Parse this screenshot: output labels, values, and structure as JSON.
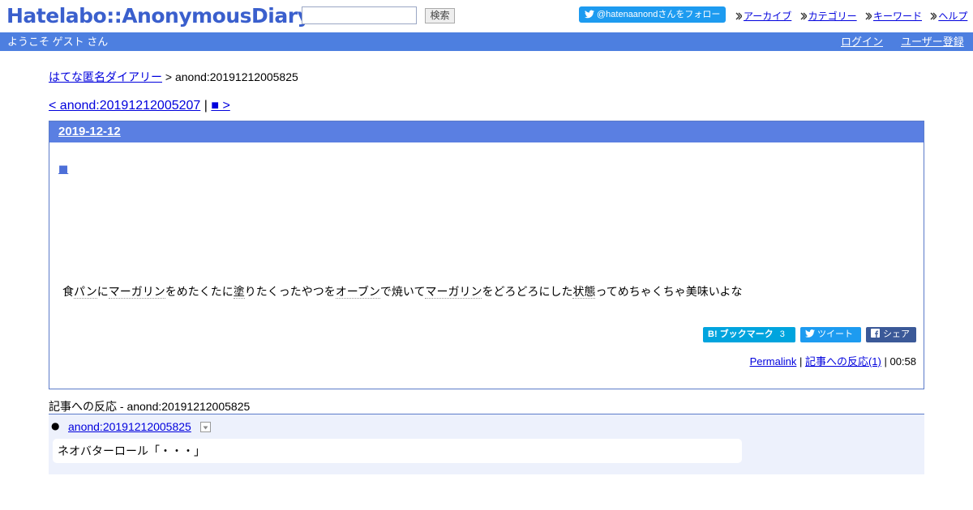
{
  "header": {
    "logo": "Hatelabo::AnonymousDiary",
    "search": {
      "value": "",
      "button": "検索"
    },
    "follow": "@hatenaanondさんをフォロー",
    "links": [
      "アーカイブ",
      "カテゴリー",
      "キーワード",
      "ヘルプ"
    ]
  },
  "welcome_bar": {
    "greeting": "ようこそ ゲスト さん",
    "login": "ログイン",
    "register": "ユーザー登録"
  },
  "breadcrumb": {
    "home": "はてな匿名ダイアリー",
    "current": " > anond:20191212005825"
  },
  "pager": {
    "prev": "< anond:20191212005207",
    "sep": " | ",
    "next": "■ >"
  },
  "entry": {
    "date": "2019-12-12",
    "section_mark": "■",
    "body": [
      {
        "t": "食",
        "kw": false
      },
      {
        "t": "パン",
        "kw": true
      },
      {
        "t": "に",
        "kw": false
      },
      {
        "t": "マーガリン",
        "kw": true
      },
      {
        "t": "をめたくたに",
        "kw": false
      },
      {
        "t": "塗",
        "kw": true
      },
      {
        "t": "りたくったやつを",
        "kw": false
      },
      {
        "t": "オーブン",
        "kw": true
      },
      {
        "t": "で焼いて",
        "kw": false
      },
      {
        "t": "マーガリン",
        "kw": true
      },
      {
        "t": "をどろどろにした",
        "kw": false
      },
      {
        "t": "状態",
        "kw": true
      },
      {
        "t": "ってめちゃくちゃ美味いよな",
        "kw": false
      }
    ],
    "share": {
      "bookmark_label": "B! ブックマーク",
      "bookmark_count": "3",
      "tweet": "ツイート",
      "share": "シェア"
    },
    "footer": {
      "permalink": "Permalink",
      "sep1": " | ",
      "reactions_link": "記事への反応(1)",
      "time": " | 00:58"
    }
  },
  "reactions": {
    "title": "記事への反応 - anond:20191212005825",
    "items": [
      {
        "link": "anond:20191212005825",
        "body": "ネオバターロール「・・・」"
      }
    ]
  },
  "colors": {
    "brand": "#3a5fcd",
    "bar": "#4d7fe0",
    "entry_head": "#5a7fe2",
    "reaction_bg": "#edf1fc"
  }
}
